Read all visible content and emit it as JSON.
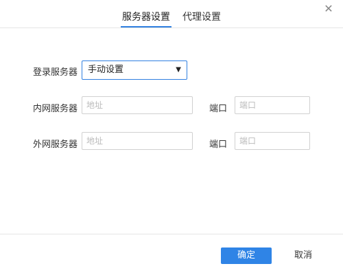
{
  "tabs": [
    {
      "label": "服务器设置",
      "active": true
    },
    {
      "label": "代理设置",
      "active": false
    }
  ],
  "login_server": {
    "label": "登录服务器",
    "selected": "手动设置"
  },
  "intranet": {
    "label": "内网服务器",
    "address_placeholder": "地址",
    "port_label": "端口",
    "port_placeholder": "端口"
  },
  "extranet": {
    "label": "外网服务器",
    "address_placeholder": "地址",
    "port_label": "端口",
    "port_placeholder": "端口"
  },
  "buttons": {
    "ok": "确定",
    "cancel": "取消"
  },
  "colors": {
    "accent": "#2f84e6"
  }
}
